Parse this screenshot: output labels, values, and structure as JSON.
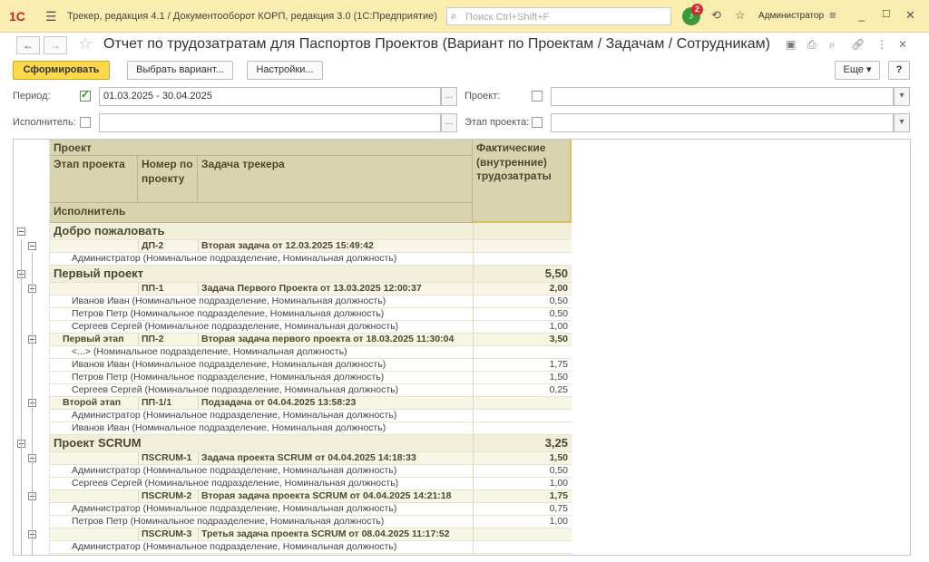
{
  "topbar": {
    "logo": "1С",
    "app_title": "Трекер, редакция 4.1 / Документооборот КОРП, редакция 3.0  (1С:Предприятие)",
    "search_placeholder": "Поиск Ctrl+Shift+F",
    "notifications_count": "2",
    "user": "Администратор"
  },
  "form": {
    "title": "Отчет по трудозатратам для Паспортов Проектов (Вариант по Проектам / Задачам / Сотрудникам)"
  },
  "toolbar": {
    "generate": "Сформировать",
    "choose_variant": "Выбрать вариант...",
    "settings": "Настройки...",
    "more": "Еще",
    "help": "?"
  },
  "filters": {
    "period_label": "Период:",
    "period_checked": true,
    "period_value": "01.03.2025 - 30.04.2025",
    "project_label": "Проект:",
    "project_value": "",
    "executor_label": "Исполнитель:",
    "executor_value": "",
    "stage_label": "Этап проекта:",
    "stage_value": ""
  },
  "report": {
    "headers": {
      "project": "Проект",
      "stage": "Этап проекта",
      "number": "Номер по проекту",
      "task": "Задача трекера",
      "executor": "Исполнитель",
      "actual": "Фактические (внутренние) трудозатраты"
    },
    "rows": [
      {
        "level": 0,
        "text": "Добро пожаловать",
        "value": ""
      },
      {
        "level": 1,
        "stage": "",
        "number": "ДП-2",
        "task": "Вторая задача от 12.03.2025 15:49:42",
        "value": ""
      },
      {
        "level": 2,
        "text": "Администратор (Номинальное подразделение, Номинальная должность)",
        "value": ""
      },
      {
        "level": 0,
        "text": "Первый проект",
        "value": "5,50"
      },
      {
        "level": 1,
        "stage": "",
        "number": "ПП-1",
        "task": "Задача Первого Проекта от 13.03.2025 12:00:37",
        "value": "2,00"
      },
      {
        "level": 2,
        "text": "Иванов Иван (Номинальное подразделение, Номинальная должность)",
        "value": "0,50"
      },
      {
        "level": 2,
        "text": "Петров Петр (Номинальное подразделение, Номинальная должность)",
        "value": "0,50"
      },
      {
        "level": 2,
        "text": "Сергеев Сергей (Номинальное подразделение, Номинальная должность)",
        "value": "1,00"
      },
      {
        "level": 1,
        "stage": "Первый этап",
        "number": "ПП-2",
        "task": "Вторая задача первого проекта от 18.03.2025 11:30:04",
        "value": "3,50"
      },
      {
        "level": 2,
        "text": "<...> (Номинальное подразделение, Номинальная должность)",
        "value": ""
      },
      {
        "level": 2,
        "text": "Иванов Иван (Номинальное подразделение, Номинальная должность)",
        "value": "1,75"
      },
      {
        "level": 2,
        "text": "Петров Петр (Номинальное подразделение, Номинальная должность)",
        "value": "1,50"
      },
      {
        "level": 2,
        "text": "Сергеев Сергей (Номинальное подразделение, Номинальная должность)",
        "value": "0,25"
      },
      {
        "level": 1,
        "stage": "Второй этап",
        "number": "ПП-1/1",
        "task": "Подзадача от 04.04.2025 13:58:23",
        "value": ""
      },
      {
        "level": 2,
        "text": "Администратор (Номинальное подразделение, Номинальная должность)",
        "value": ""
      },
      {
        "level": 2,
        "text": "Иванов Иван (Номинальное подразделение, Номинальная должность)",
        "value": ""
      },
      {
        "level": 0,
        "text": "Проект SCRUM",
        "value": "3,25"
      },
      {
        "level": 1,
        "stage": "",
        "number": "ПSCRUM-1",
        "task": "Задача проекта SCRUM от 04.04.2025 14:18:33",
        "value": "1,50"
      },
      {
        "level": 2,
        "text": "Администратор (Номинальное подразделение, Номинальная должность)",
        "value": "0,50"
      },
      {
        "level": 2,
        "text": "Сергеев Сергей (Номинальное подразделение, Номинальная должность)",
        "value": "1,00"
      },
      {
        "level": 1,
        "stage": "",
        "number": "ПSCRUM-2",
        "task": "Вторая задача проекта SCRUM от 04.04.2025 14:21:18",
        "value": "1,75"
      },
      {
        "level": 2,
        "text": "Администратор (Номинальное подразделение, Номинальная должность)",
        "value": "0,75"
      },
      {
        "level": 2,
        "text": "Петров Петр (Номинальное подразделение, Номинальная должность)",
        "value": "1,00"
      },
      {
        "level": 1,
        "stage": "",
        "number": "ПSCRUM-3",
        "task": "Третья задача проекта SCRUM от 08.04.2025 11:17:52",
        "value": ""
      },
      {
        "level": 2,
        "text": "Администратор (Номинальное подразделение, Номинальная должность)",
        "value": ""
      }
    ]
  }
}
